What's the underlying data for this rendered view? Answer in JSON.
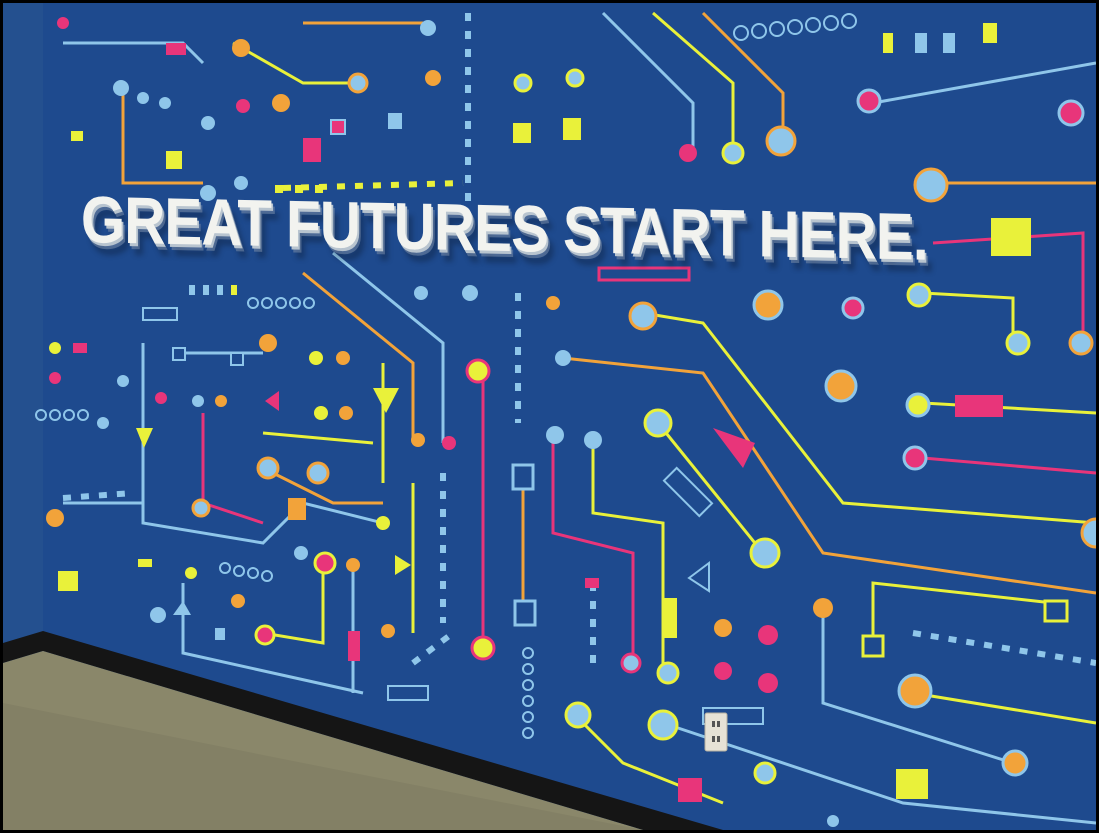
{
  "sign": {
    "headline": "GREAT FUTURES START HERE."
  },
  "colors": {
    "wall": "#1f4a8f",
    "trace_blue": "#8fc6ea",
    "trace_orange": "#f2a33a",
    "trace_pink": "#e8357a",
    "trace_yellow": "#e9f13a",
    "letters": "#f2f3ef",
    "floor": "#8c8a6c",
    "baseboard": "#1a1a1a"
  },
  "scene": {
    "wall_mural": "circuit-board",
    "outlet": "electrical-outlet"
  }
}
